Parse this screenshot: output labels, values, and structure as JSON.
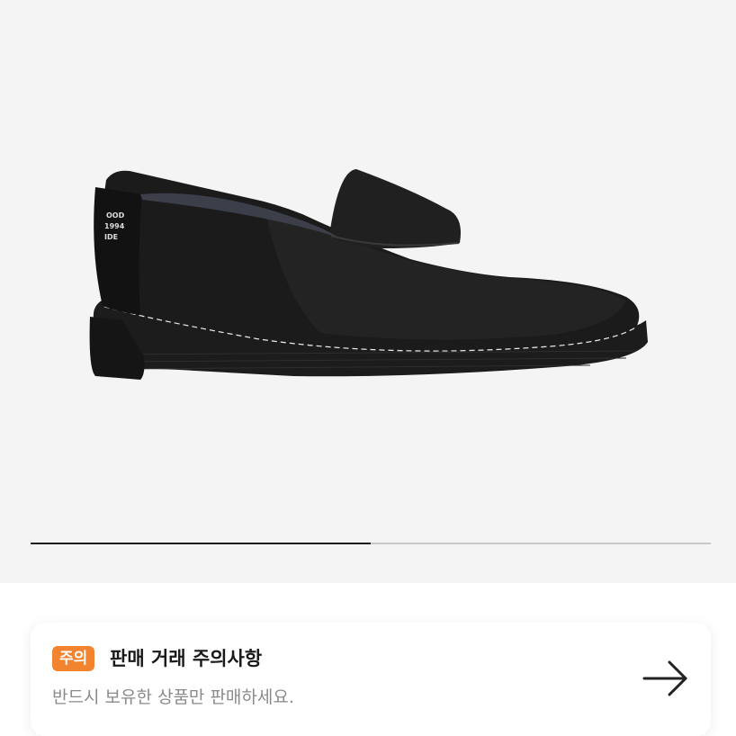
{
  "product": {
    "image_alt": "black suede penny loafer",
    "heel_print_lines": [
      "OOD",
      "1994",
      "IDE"
    ]
  },
  "gallery": {
    "progress": 0.5
  },
  "notice": {
    "badge": "주의",
    "title": "판매 거래 주의사항",
    "subtitle": "반드시 보유한 상품만 판매하세요.",
    "icon": "arrow-right-icon",
    "badge_color": "#f2832f"
  }
}
